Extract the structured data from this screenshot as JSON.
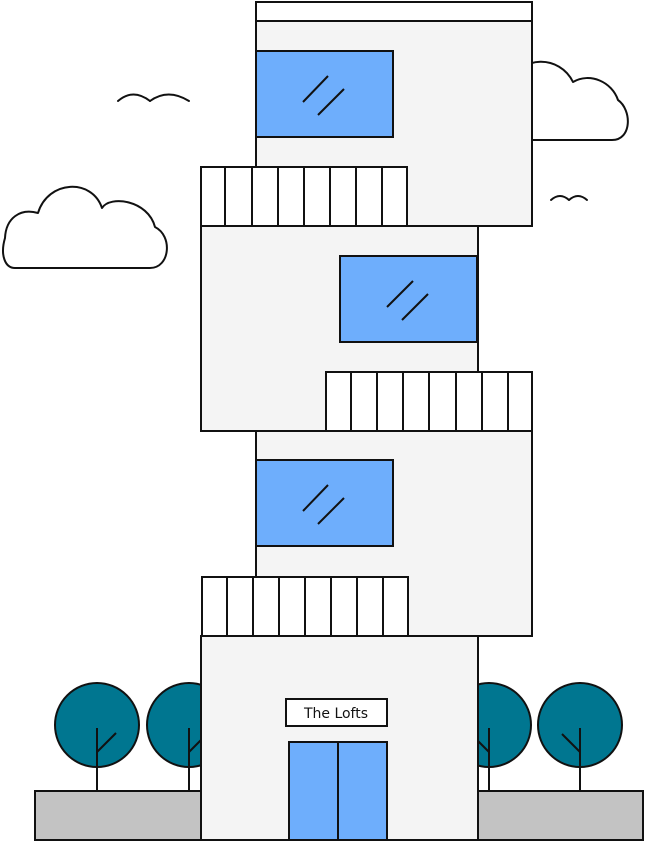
{
  "building": {
    "sign_text": "The Lofts"
  },
  "colors": {
    "outline": "#111111",
    "wall": "#f4f4f4",
    "window": "#6eaefc",
    "tree": "#007690",
    "ground": "#c3c3c3",
    "sky": "#ffffff"
  },
  "icons": {
    "cloud": "cloud-icon",
    "bird": "bird-icon",
    "tree": "tree-icon"
  }
}
